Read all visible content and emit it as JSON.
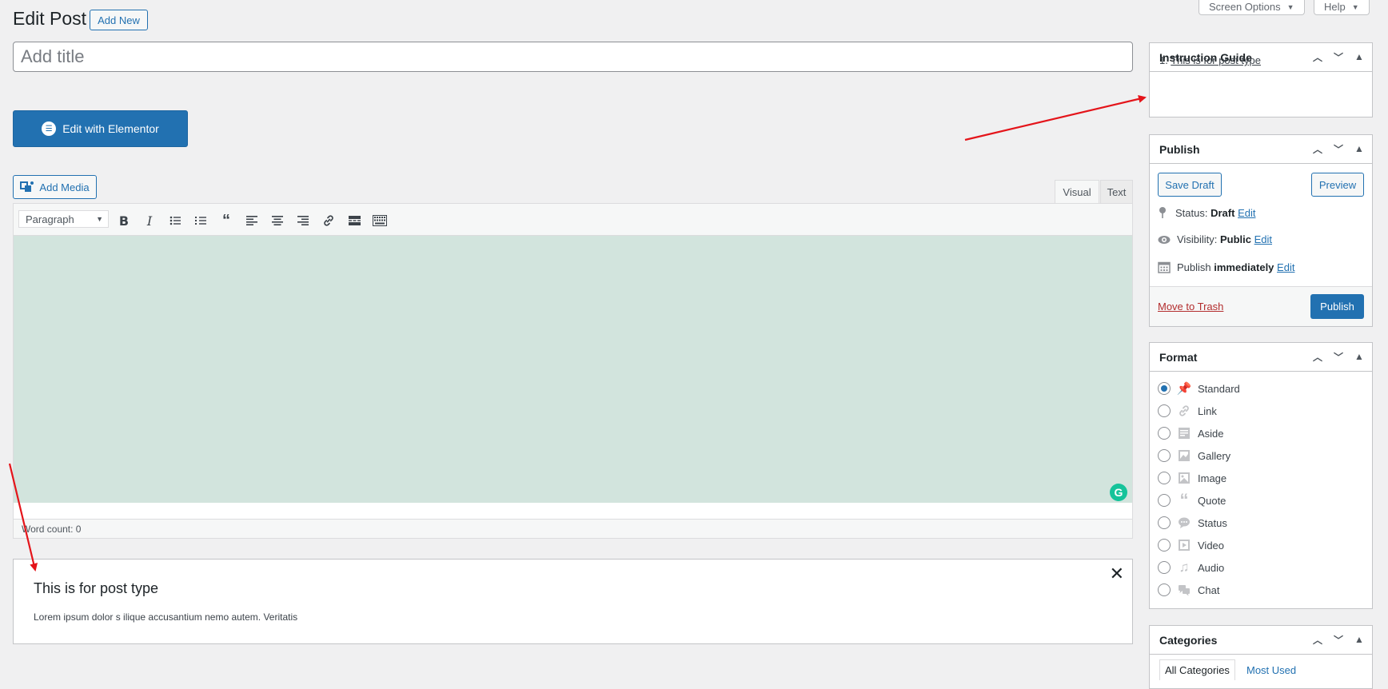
{
  "top_tabs": {
    "screen_options": "Screen Options",
    "help": "Help"
  },
  "header": {
    "title": "Edit Post",
    "add_new": "Add New"
  },
  "title_field": {
    "placeholder": "Add title",
    "value": ""
  },
  "elementor": {
    "label": "Edit with Elementor"
  },
  "media": {
    "add_media": "Add Media"
  },
  "editor": {
    "tabs": [
      "Visual",
      "Text"
    ],
    "active_tab": "Visual",
    "format_select": "Paragraph",
    "toolbar_icons": [
      "bold-icon",
      "italic-icon",
      "bullet-list-icon",
      "numbered-list-icon",
      "blockquote-icon",
      "align-left-icon",
      "align-center-icon",
      "align-right-icon",
      "link-icon",
      "read-more-icon",
      "toolbar-toggle-icon"
    ],
    "body_color": "#d2e4dd",
    "word_count": "Word count: 0"
  },
  "notice": {
    "title": "This is for post type",
    "body": "Lorem ipsum dolor s ilique accusantium nemo autem. Veritatis"
  },
  "instruction_guide": {
    "title": "Instruction Guide",
    "item_number": "1.",
    "item_link": "This is for post type"
  },
  "publish": {
    "title": "Publish",
    "save_draft": "Save Draft",
    "preview": "Preview",
    "status_label": "Status:",
    "status_value": "Draft",
    "visibility_label": "Visibility:",
    "visibility_value": "Public",
    "publish_label": "Publish",
    "publish_value": "immediately",
    "edit": "Edit",
    "move_to_trash": "Move to Trash",
    "publish_button": "Publish"
  },
  "format": {
    "title": "Format",
    "options": [
      "Standard",
      "Link",
      "Aside",
      "Gallery",
      "Image",
      "Quote",
      "Status",
      "Video",
      "Audio",
      "Chat"
    ],
    "selected": "Standard"
  },
  "categories": {
    "title": "Categories",
    "tab_all": "All Categories",
    "tab_most_used": "Most Used"
  },
  "colors": {
    "primary": "#2271b1",
    "trash": "#b32d2e",
    "annotation_arrow": "#e4141a"
  }
}
